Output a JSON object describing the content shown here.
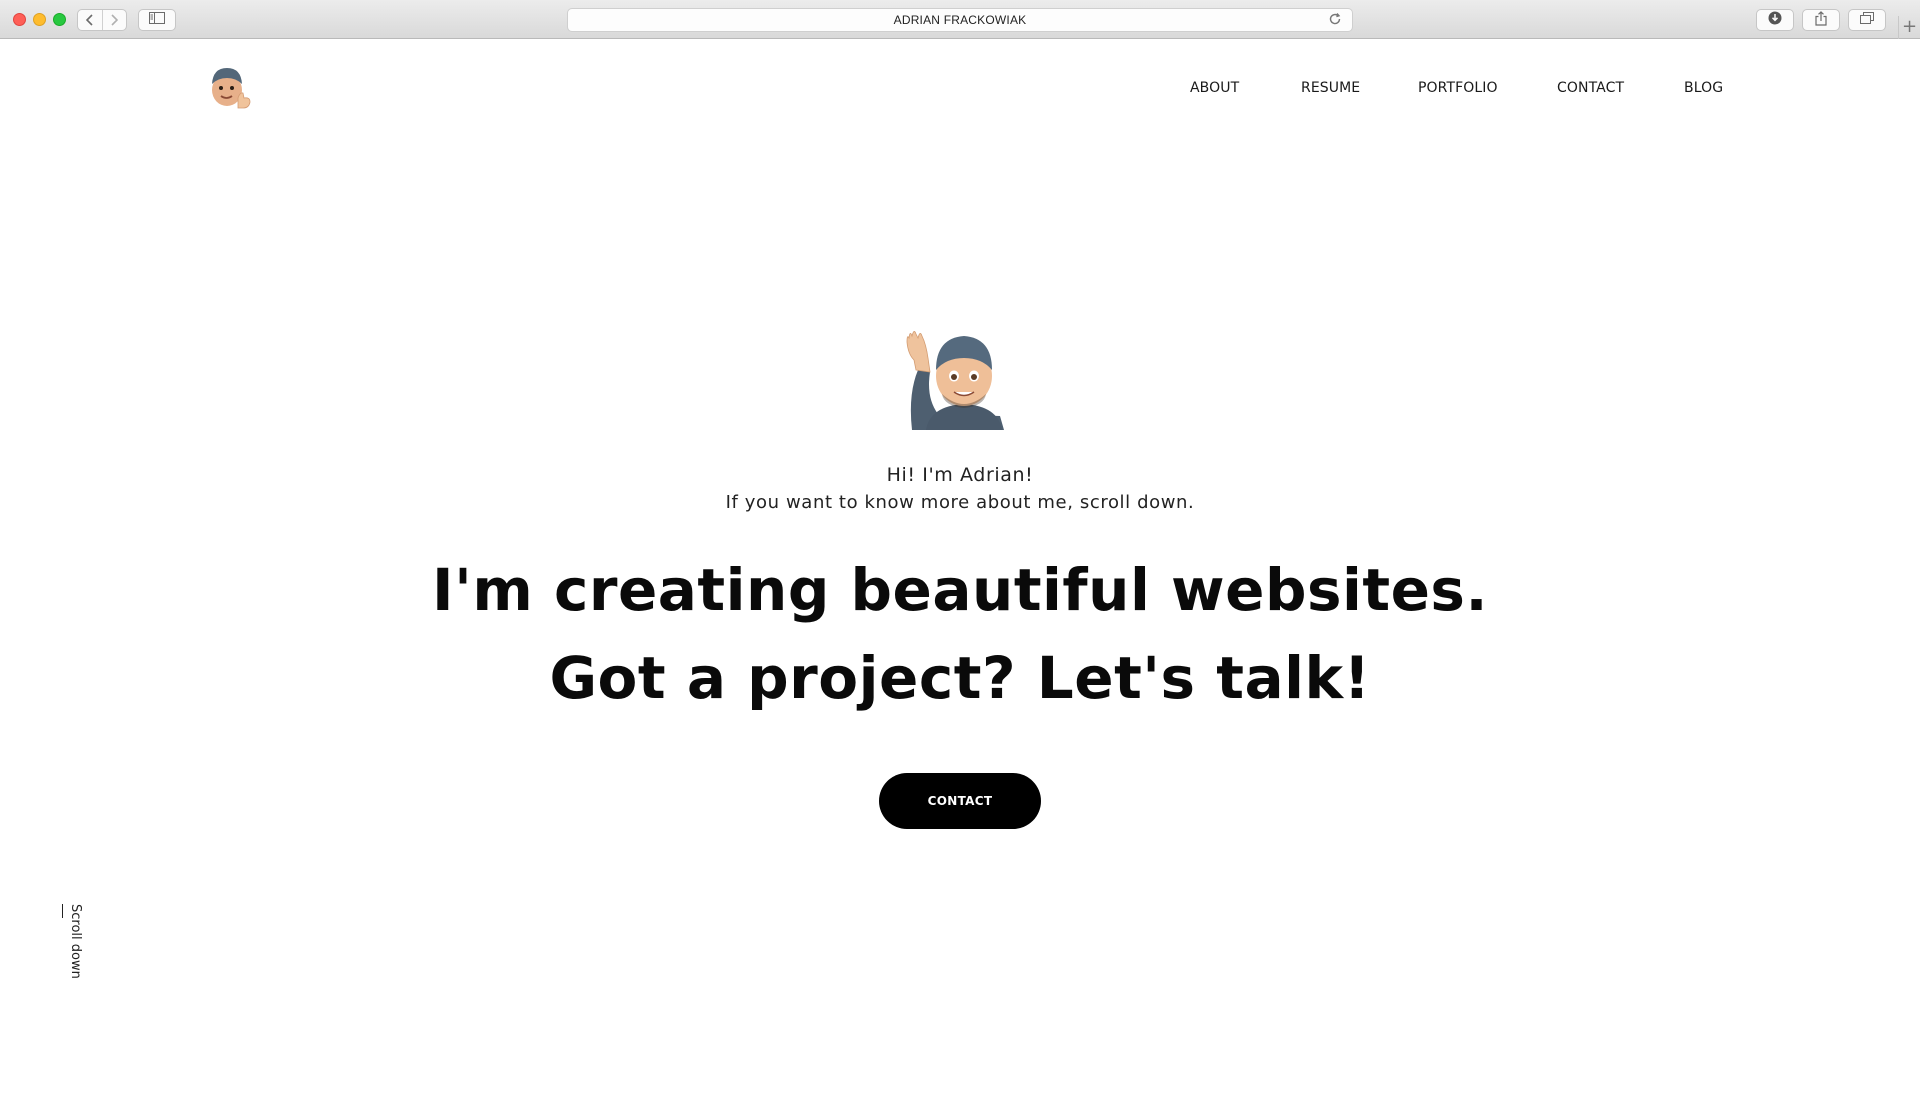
{
  "browser": {
    "address_text": "ADRIAN FRACKOWIAK",
    "back_icon": "chevron-left-icon",
    "forward_icon": "chevron-right-icon",
    "sidebar_icon": "sidebar-icon",
    "reload_icon": "reload-icon",
    "download_icon": "download-icon",
    "share_icon": "share-icon",
    "tabs_icon": "tabs-icon",
    "new_tab_label": "+"
  },
  "header": {
    "logo_icon": "memoji-thumbs-up-icon",
    "nav": [
      {
        "label": "ABOUT"
      },
      {
        "label": "RESUME"
      },
      {
        "label": "PORTFOLIO"
      },
      {
        "label": "CONTACT"
      },
      {
        "label": "BLOG"
      }
    ]
  },
  "hero": {
    "avatar_icon": "memoji-waving-icon",
    "greeting_line1": "Hi! I'm Adrian!",
    "greeting_line2": "If you want to know more about me, scroll down.",
    "headline_line1": "I'm creating beautiful websites.",
    "headline_line2": "Got a project? Let's talk!",
    "cta_label": "CONTACT"
  },
  "scroll_hint": {
    "label": "Scroll down"
  },
  "colors": {
    "cta_background": "#000000",
    "cta_text": "#ffffff",
    "page_background": "#ffffff"
  }
}
